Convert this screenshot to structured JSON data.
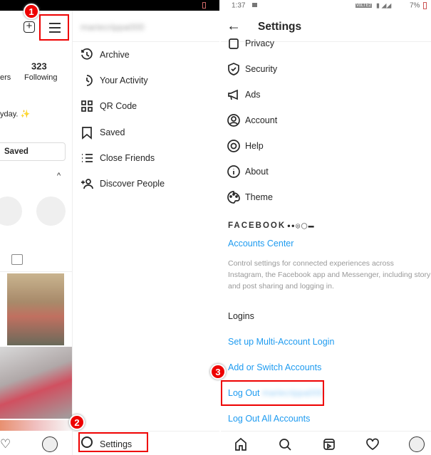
{
  "left": {
    "profile": {
      "following_count": "323",
      "following_label": "Following",
      "followers_label_partial": "ers",
      "bio_partial": "yday. ✨",
      "saved_button": "Saved"
    },
    "drawer": {
      "username": "mariecrippa000",
      "items": [
        {
          "label": "Archive",
          "icon": "archive-icon"
        },
        {
          "label": "Your Activity",
          "icon": "activity-icon"
        },
        {
          "label": "QR Code",
          "icon": "qr-code-icon"
        },
        {
          "label": "Saved",
          "icon": "bookmark-icon"
        },
        {
          "label": "Close Friends",
          "icon": "close-friends-icon"
        },
        {
          "label": "Discover People",
          "icon": "add-person-icon"
        }
      ],
      "settings_label": "Settings"
    }
  },
  "right": {
    "status": {
      "time": "1:37",
      "battery": "7%",
      "network": "VoLTE2"
    },
    "header": {
      "title": "Settings"
    },
    "items": [
      {
        "label": "Privacy",
        "icon": "lock-icon"
      },
      {
        "label": "Security",
        "icon": "shield-icon"
      },
      {
        "label": "Ads",
        "icon": "megaphone-icon"
      },
      {
        "label": "Account",
        "icon": "account-icon"
      },
      {
        "label": "Help",
        "icon": "help-icon"
      },
      {
        "label": "About",
        "icon": "info-icon"
      },
      {
        "label": "Theme",
        "icon": "palette-icon"
      }
    ],
    "facebook": {
      "heading": "FACEBOOK",
      "accounts_center": "Accounts Center",
      "description_lines": [
        "Control settings for connected experiences across",
        "Instagram, the Facebook app and Messenger, including story",
        "and post sharing and logging in."
      ]
    },
    "logins": {
      "heading": "Logins",
      "setup_multi": "Set up Multi-Account Login",
      "add_switch": "Add or Switch Accounts",
      "log_out": "Log Out",
      "log_out_user": "mariecrippa000",
      "log_out_all": "Log Out All Accounts"
    }
  },
  "annotations": {
    "step1": "1",
    "step2": "2",
    "step3": "3"
  },
  "colors": {
    "link": "#1e9bf0",
    "highlight": "#e00000"
  }
}
